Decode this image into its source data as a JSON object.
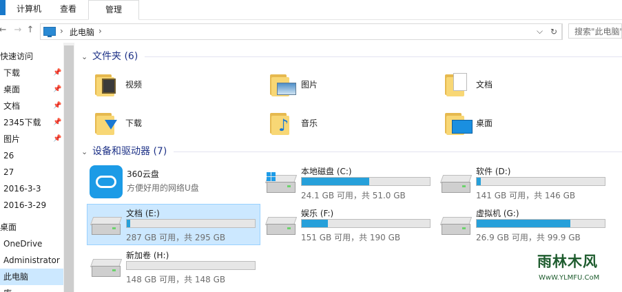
{
  "ribbon": {
    "tabs": [
      {
        "label": "计算机"
      },
      {
        "label": "查看"
      },
      {
        "label": "管理"
      }
    ]
  },
  "address": {
    "crumb_sep": "›",
    "location": "此电脑",
    "dropdown": "⌵",
    "refresh": "↻",
    "search_placeholder": "搜索\"此电脑\""
  },
  "nav": {
    "back": "←",
    "forward": "→",
    "up": "↑"
  },
  "sidebar": {
    "items": [
      {
        "label": "快速访问"
      },
      {
        "label": "下载",
        "pinned": true
      },
      {
        "label": "桌面",
        "pinned": true
      },
      {
        "label": "文档",
        "pinned": true
      },
      {
        "label": "2345下载",
        "pinned": true
      },
      {
        "label": "图片",
        "pinned": true
      },
      {
        "label": "26"
      },
      {
        "label": "27"
      },
      {
        "label": "2016-3-3"
      },
      {
        "label": "2016-3-29"
      },
      {
        "label": "桌面"
      },
      {
        "label": "OneDrive"
      },
      {
        "label": "Administrator"
      },
      {
        "label": "此电脑",
        "selected": true
      },
      {
        "label": "库"
      }
    ],
    "pin_glyph": "📌"
  },
  "folders_group": {
    "title": "文件夹 (6)",
    "chevron": "⌄"
  },
  "folders": [
    {
      "name": "视频",
      "icon": "video-folder-icon"
    },
    {
      "name": "图片",
      "icon": "pictures-folder-icon"
    },
    {
      "name": "文档",
      "icon": "documents-folder-icon"
    },
    {
      "name": "下载",
      "icon": "downloads-folder-icon"
    },
    {
      "name": "音乐",
      "icon": "music-folder-icon"
    },
    {
      "name": "桌面",
      "icon": "desktop-folder-icon"
    }
  ],
  "devices_group": {
    "title": "设备和驱动器 (7)",
    "chevron": "⌄"
  },
  "cloud_drive": {
    "name": "360云盘",
    "subtitle": "方便好用的网络U盘"
  },
  "drives": [
    {
      "name": "本地磁盘 (C:)",
      "free": "24.1 GB 可用，共 51.0 GB",
      "used_fraction": 0.527,
      "system": true
    },
    {
      "name": "软件 (D:)",
      "free": "141 GB 可用，共 146 GB",
      "used_fraction": 0.034
    },
    {
      "name": "文档 (E:)",
      "free": "287 GB 可用，共 295 GB",
      "used_fraction": 0.027,
      "selected": true
    },
    {
      "name": "娱乐 (F:)",
      "free": "151 GB 可用，共 190 GB",
      "used_fraction": 0.205
    },
    {
      "name": "虚拟机 (G:)",
      "free": "26.9 GB 可用，共 99.9 GB",
      "used_fraction": 0.731
    },
    {
      "name": "新加卷 (H:)",
      "free": "148 GB 可用，共 148 GB",
      "used_fraction": 0.0
    }
  ],
  "colors": {
    "accent": "#26a0da",
    "selection": "#cce8ff",
    "group_header": "#1e3287",
    "folder": "#f8d775"
  },
  "watermark": {
    "text": "雨林木风",
    "url": "WwW.YLMFU.CoM"
  }
}
